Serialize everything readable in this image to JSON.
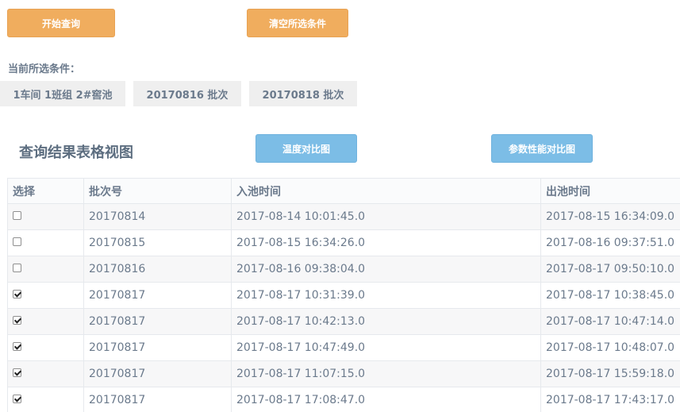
{
  "toolbar": {
    "start_query_label": "开始查询",
    "clear_conditions_label": "清空所选条件"
  },
  "conditions": {
    "label": "当前所选条件：",
    "chips": [
      "1车间 1班组 2#窖池",
      "20170816 批次",
      "20170818 批次"
    ]
  },
  "results": {
    "title": "查询结果表格视图",
    "temp_compare_label": "温度对比图",
    "param_compare_label": "参数性能对比图"
  },
  "table": {
    "headers": [
      "选择",
      "批次号",
      "入池时间",
      "出池时间"
    ],
    "rows": [
      {
        "checked": false,
        "batch": "20170814",
        "in_time": "2017-08-14 10:01:45.0",
        "out_time": "2017-08-15 16:34:09.0"
      },
      {
        "checked": false,
        "batch": "20170815",
        "in_time": "2017-08-15 16:34:26.0",
        "out_time": "2017-08-16 09:37:51.0"
      },
      {
        "checked": false,
        "batch": "20170816",
        "in_time": "2017-08-16 09:38:04.0",
        "out_time": "2017-08-17 09:50:10.0"
      },
      {
        "checked": true,
        "batch": "20170817",
        "in_time": "2017-08-17 10:31:39.0",
        "out_time": "2017-08-17 10:38:45.0"
      },
      {
        "checked": true,
        "batch": "20170817",
        "in_time": "2017-08-17 10:42:13.0",
        "out_time": "2017-08-17 10:47:14.0"
      },
      {
        "checked": true,
        "batch": "20170817",
        "in_time": "2017-08-17 10:47:49.0",
        "out_time": "2017-08-17 10:48:07.0"
      },
      {
        "checked": true,
        "batch": "20170817",
        "in_time": "2017-08-17 11:07:15.0",
        "out_time": "2017-08-17 15:59:18.0"
      },
      {
        "checked": true,
        "batch": "20170817",
        "in_time": "2017-08-17 17:08:47.0",
        "out_time": "2017-08-17 17:43:17.0"
      }
    ]
  },
  "colors": {
    "orange_button": "#f0ad5e",
    "blue_button": "#7cbde6",
    "text": "#6b7a8c"
  }
}
